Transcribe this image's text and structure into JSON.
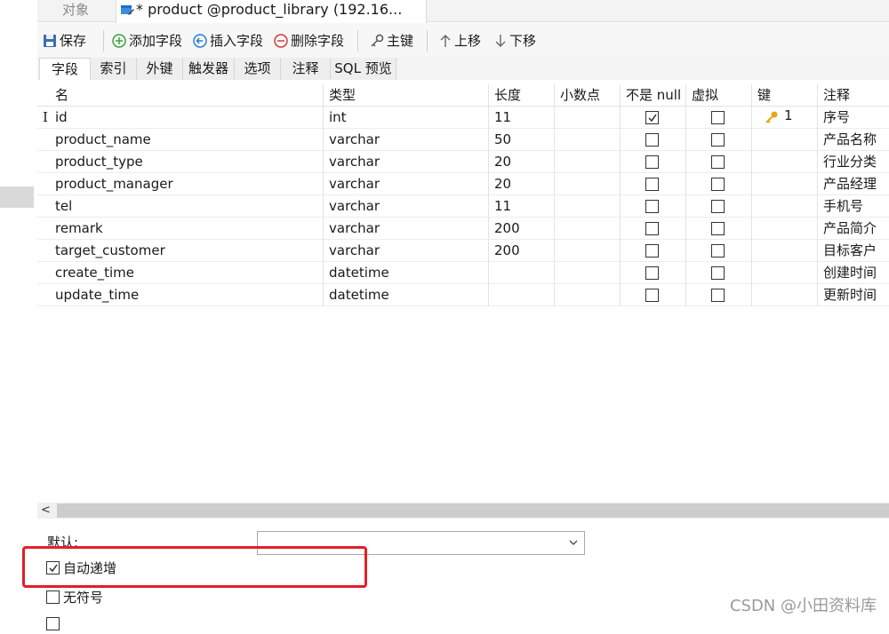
{
  "window": {
    "objects_tab": "对象",
    "active_tab": "* product @product_library (192.16..."
  },
  "toolbar": {
    "save": "保存",
    "add_field": "添加字段",
    "insert_field": "插入字段",
    "delete_field": "删除字段",
    "primary_key": "主键",
    "move_up": "上移",
    "move_down": "下移"
  },
  "subtabs": [
    "字段",
    "索引",
    "外键",
    "触发器",
    "选项",
    "注释",
    "SQL 预览"
  ],
  "columns": [
    "名",
    "类型",
    "长度",
    "小数点",
    "不是 null",
    "虚拟",
    "键",
    "注释"
  ],
  "rows": [
    {
      "name": "id",
      "type": "int",
      "length": "11",
      "decimal": "",
      "not_null": true,
      "virtual": false,
      "key": "1",
      "comment": "序号"
    },
    {
      "name": "product_name",
      "type": "varchar",
      "length": "50",
      "decimal": "",
      "not_null": false,
      "virtual": false,
      "key": "",
      "comment": "产品名称"
    },
    {
      "name": "product_type",
      "type": "varchar",
      "length": "20",
      "decimal": "",
      "not_null": false,
      "virtual": false,
      "key": "",
      "comment": "行业分类"
    },
    {
      "name": "product_manager",
      "type": "varchar",
      "length": "20",
      "decimal": "",
      "not_null": false,
      "virtual": false,
      "key": "",
      "comment": "产品经理"
    },
    {
      "name": "tel",
      "type": "varchar",
      "length": "11",
      "decimal": "",
      "not_null": false,
      "virtual": false,
      "key": "",
      "comment": "手机号"
    },
    {
      "name": "remark",
      "type": "varchar",
      "length": "200",
      "decimal": "",
      "not_null": false,
      "virtual": false,
      "key": "",
      "comment": "产品简介"
    },
    {
      "name": "target_customer",
      "type": "varchar",
      "length": "200",
      "decimal": "",
      "not_null": false,
      "virtual": false,
      "key": "",
      "comment": "目标客户"
    },
    {
      "name": "create_time",
      "type": "datetime",
      "length": "",
      "decimal": "",
      "not_null": false,
      "virtual": false,
      "key": "",
      "comment": "创建时间"
    },
    {
      "name": "update_time",
      "type": "datetime",
      "length": "",
      "decimal": "",
      "not_null": false,
      "virtual": false,
      "key": "",
      "comment": "更新时间"
    }
  ],
  "properties": {
    "default_label": "默认:",
    "default_value": "",
    "auto_increment_label": "自动递增",
    "auto_increment": true,
    "unsigned_label": "无符号",
    "unsigned": false
  },
  "watermark": "CSDN @小田资料库",
  "colors": {
    "highlight": "#e0202a",
    "key_icon": "#e6a417"
  }
}
